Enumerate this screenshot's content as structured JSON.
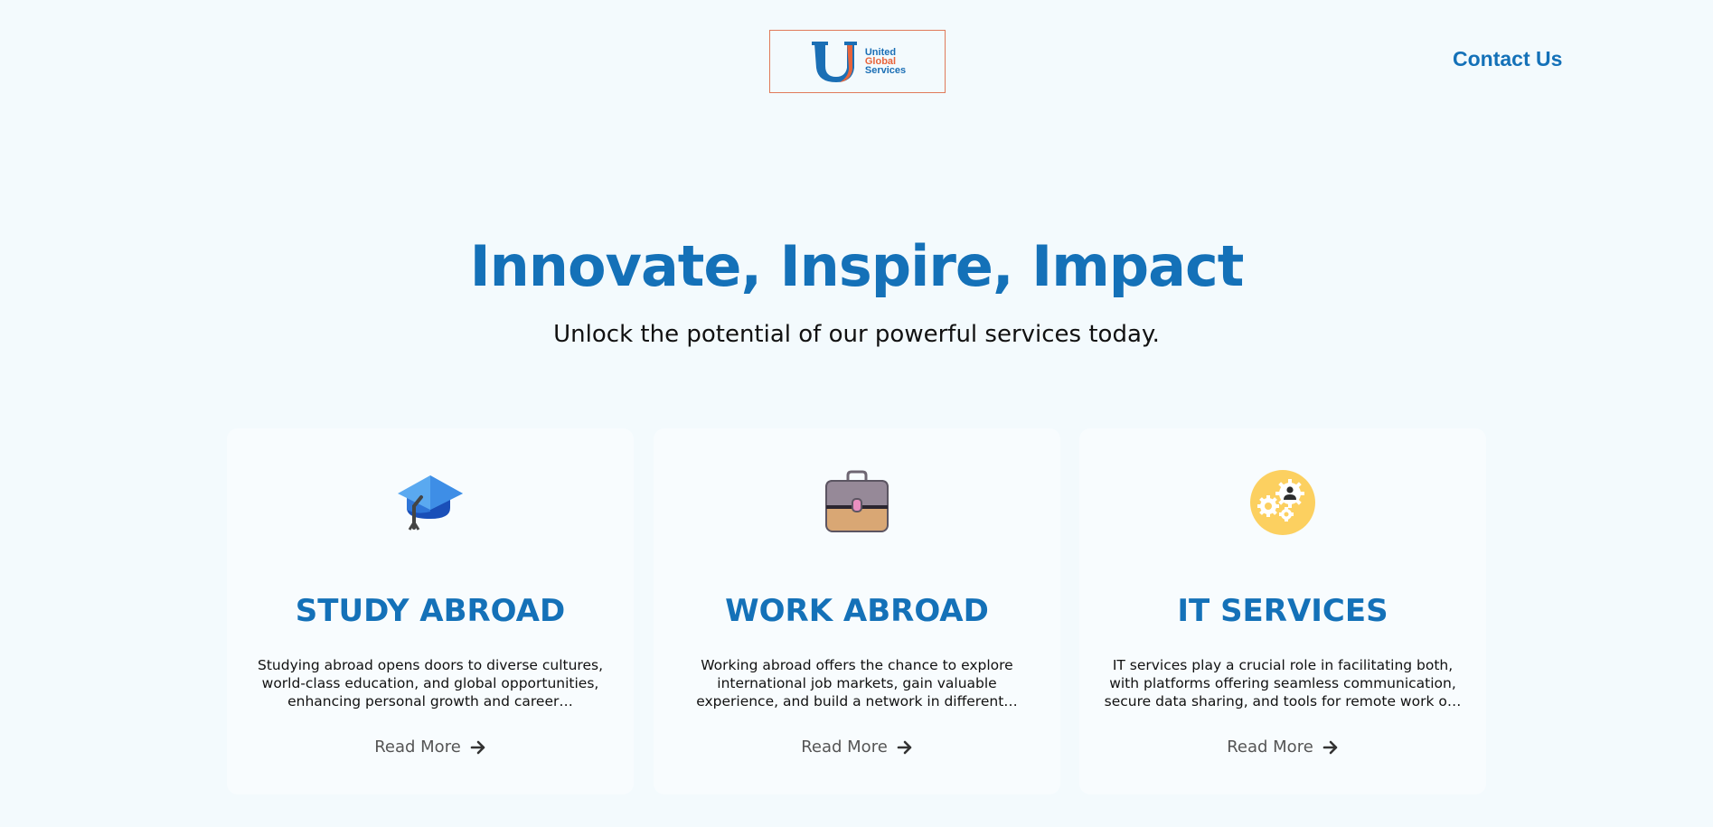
{
  "header": {
    "logo": {
      "line1": "United",
      "line2": "Global",
      "line3": "Services",
      "color_blue": "#1b6fb5",
      "color_orange": "#e8643b"
    },
    "contact_label": "Contact Us"
  },
  "hero": {
    "title": "Innovate, Inspire, Impact",
    "subtitle": "Unlock the potential of our powerful services today."
  },
  "cards": [
    {
      "icon": "graduation-cap-icon",
      "title": "STUDY ABROAD",
      "description": "Studying abroad opens doors to diverse cultures, world-class education, and global opportunities, enhancing personal growth and career…",
      "read_more": "Read More"
    },
    {
      "icon": "briefcase-icon",
      "title": "WORK ABROAD",
      "description": "Working abroad offers the chance to explore international job markets, gain valuable experience, and build a network in different…",
      "read_more": "Read More"
    },
    {
      "icon": "gears-person-icon",
      "title": "IT SERVICES",
      "description": "IT services play a crucial role in facilitating both, with platforms offering seamless communication, secure data sharing, and tools for remote work o…",
      "read_more": "Read More"
    }
  ],
  "colors": {
    "accent": "#1471b8",
    "background": "#f3fafd",
    "card": "#f8fcfe"
  }
}
